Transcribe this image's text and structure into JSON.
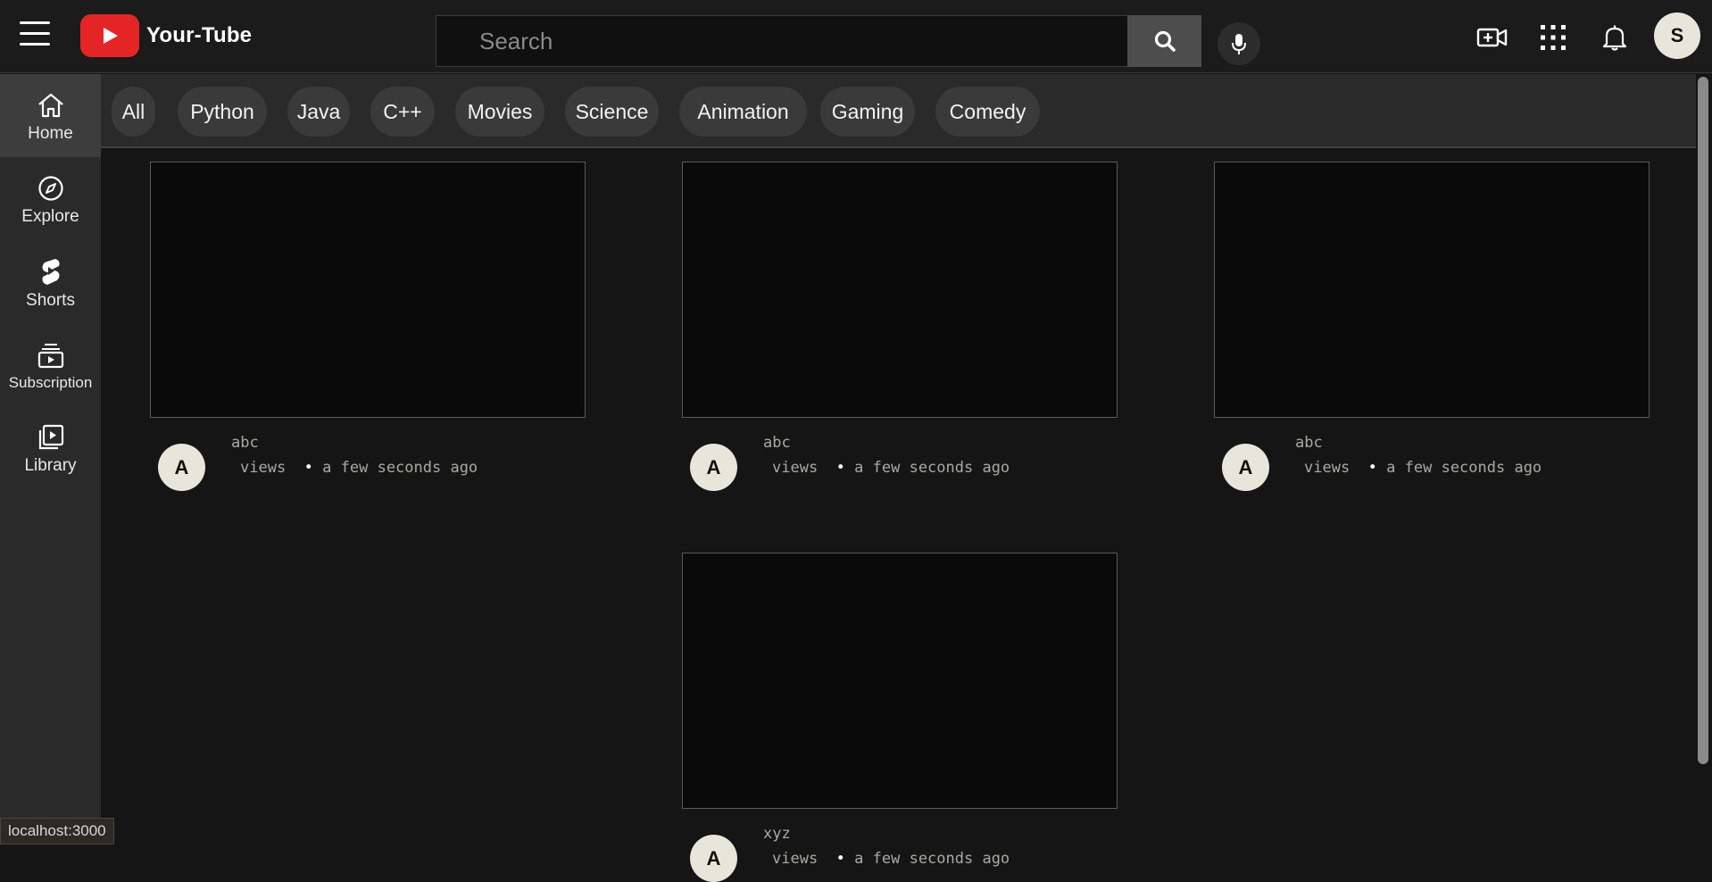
{
  "header": {
    "logo_text": "Your-Tube",
    "search_placeholder": "Search",
    "user_initial": "S"
  },
  "sidebar": {
    "items": [
      {
        "label": "Home",
        "icon": "home-icon",
        "active": true
      },
      {
        "label": "Explore",
        "icon": "compass-icon",
        "active": false
      },
      {
        "label": "Shorts",
        "icon": "shorts-icon",
        "active": false
      },
      {
        "label": "Subscription",
        "icon": "subscription-icon",
        "active": false
      },
      {
        "label": "Library",
        "icon": "library-icon",
        "active": false
      }
    ]
  },
  "chips": [
    "All",
    "Python",
    "Java",
    "C++",
    "Movies",
    "Science",
    "Animation",
    "Gaming",
    "Comedy"
  ],
  "videos": [
    {
      "title": "abc",
      "channel_initial": "A",
      "views_label": "views",
      "separator": "•",
      "time": "a few seconds ago"
    },
    {
      "title": "abc",
      "channel_initial": "A",
      "views_label": "views",
      "separator": "•",
      "time": "a few seconds ago"
    },
    {
      "title": "abc",
      "channel_initial": "A",
      "views_label": "views",
      "separator": "•",
      "time": "a few seconds ago"
    },
    {
      "title": "xyz",
      "channel_initial": "A",
      "views_label": "views",
      "separator": "•",
      "time": "a few seconds ago"
    }
  ],
  "status_bar": {
    "url": "localhost:3000"
  },
  "colors": {
    "brand_red": "#e52525",
    "background": "#151515",
    "sidebar": "#2a2a2a"
  }
}
